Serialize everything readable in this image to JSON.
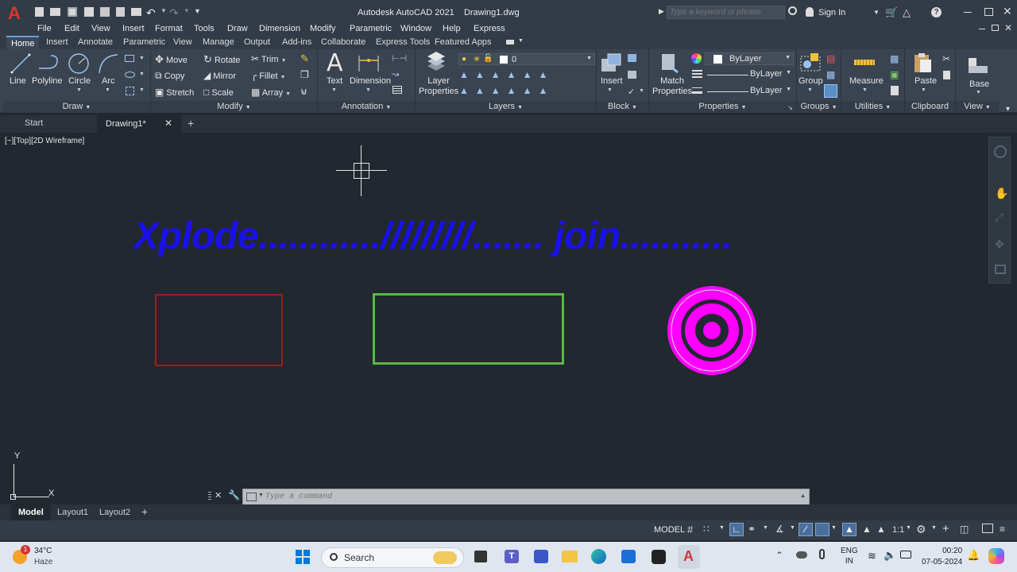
{
  "title": {
    "app": "Autodesk AutoCAD 2021",
    "file": "Drawing1.dwg",
    "search_placeholder": "Type a keyword or phrase",
    "sign_in": "Sign In"
  },
  "menu": [
    "File",
    "Edit",
    "View",
    "Insert",
    "Format",
    "Tools",
    "Draw",
    "Dimension",
    "Modify",
    "Parametric",
    "Window",
    "Help",
    "Express"
  ],
  "ribbon_tabs": [
    "Home",
    "Insert",
    "Annotate",
    "Parametric",
    "View",
    "Manage",
    "Output",
    "Add-ins",
    "Collaborate",
    "Express Tools",
    "Featured Apps"
  ],
  "draw": {
    "title": "Draw",
    "line": "Line",
    "polyline": "Polyline",
    "circle": "Circle",
    "arc": "Arc"
  },
  "modify": {
    "title": "Modify",
    "move": "Move",
    "rotate": "Rotate",
    "trim": "Trim",
    "copy": "Copy",
    "mirror": "Mirror",
    "fillet": "Fillet",
    "stretch": "Stretch",
    "scale": "Scale",
    "array": "Array"
  },
  "annotation": {
    "title": "Annotation",
    "text": "Text",
    "dimension": "Dimension"
  },
  "layers": {
    "title": "Layers",
    "layer_properties_1": "Layer",
    "layer_properties_2": "Properties",
    "current_layer": "0"
  },
  "block": {
    "title": "Block",
    "insert": "Insert"
  },
  "properties": {
    "title": "Properties",
    "match_1": "Match",
    "match_2": "Properties",
    "color": "ByLayer",
    "linetype": "ByLayer",
    "lineweight": "ByLayer"
  },
  "groups": {
    "title": "Groups",
    "group": "Group"
  },
  "utilities": {
    "title": "Utilities",
    "measure": "Measure"
  },
  "clipboard": {
    "title": "Clipboard",
    "paste": "Paste"
  },
  "view": {
    "title": "View",
    "base": "Base"
  },
  "doctabs": {
    "start": "Start",
    "drawing": "Drawing1*"
  },
  "viewport_label": "[−][Top][2D Wireframe]",
  "canvas_text": "Xplode............/////////....... join...........",
  "colors": {
    "text": "#1a10e8",
    "rect1": "#a11d1d",
    "rect2": "#5ab845",
    "target": "#ff00ff"
  },
  "command_placeholder": "Type a command",
  "layout_tabs": [
    "Model",
    "Layout1",
    "Layout2"
  ],
  "status": {
    "model": "MODEL",
    "scale": "1:1"
  },
  "taskbar": {
    "temp": "34°C",
    "weather": "Haze",
    "search": "Search",
    "lang1": "ENG",
    "lang2": "IN",
    "time": "00:20",
    "date": "07-05-2024",
    "badge": "1"
  }
}
